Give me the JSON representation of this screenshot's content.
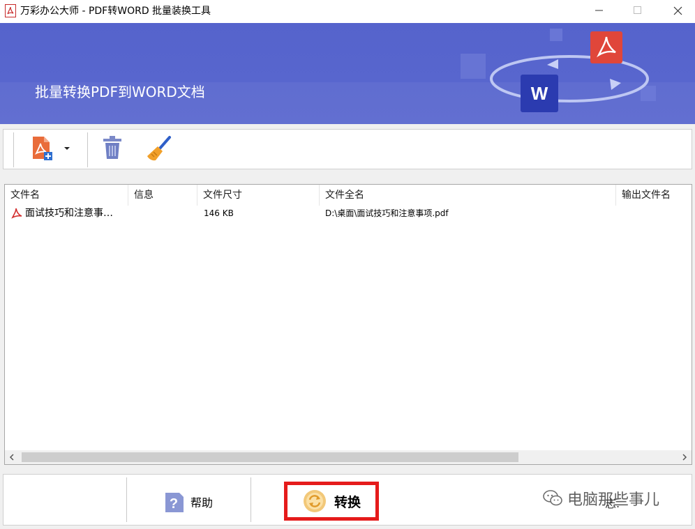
{
  "window": {
    "title": "万彩办公大师 - PDF转WORD 批量装换工具"
  },
  "banner": {
    "headline": "批量转换PDF到WORD文档",
    "word_letter": "W"
  },
  "toolbar": {
    "add_file_icon": "add-pdf-icon",
    "delete_icon": "trash-icon",
    "clear_icon": "broom-icon"
  },
  "list": {
    "columns": [
      "文件名",
      "信息",
      "文件尺寸",
      "文件全名",
      "输出文件名"
    ],
    "rows": [
      {
        "name": "面试技巧和注意事…",
        "info": "",
        "size": "146 KB",
        "full_name": "D:\\桌面\\面试技巧和注意事项.pdf",
        "output_name": ""
      }
    ]
  },
  "bottom": {
    "help_label": "帮助",
    "convert_label": "转换",
    "log_label": "志."
  },
  "watermark": {
    "text": "电脑那些事儿"
  },
  "colors": {
    "banner": "#5563cc",
    "pdf_red": "#e0463a",
    "word_blue": "#2b3bb0",
    "highlight_red": "#e51b1b"
  }
}
